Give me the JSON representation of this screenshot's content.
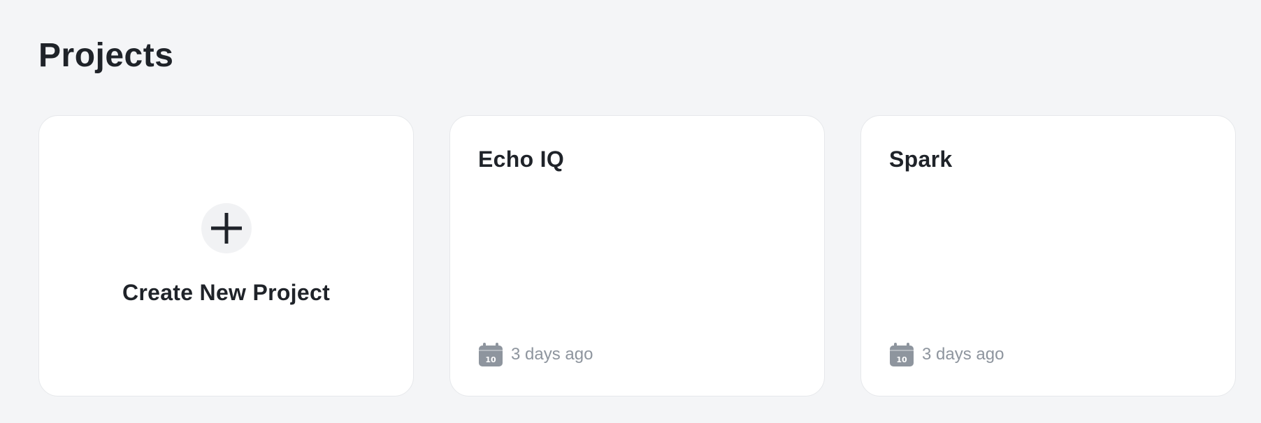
{
  "page": {
    "title": "Projects"
  },
  "create_card": {
    "label": "Create New Project",
    "icon": "plus-icon"
  },
  "projects": [
    {
      "name": "Echo IQ",
      "updated": "3 days ago",
      "icon": "calendar-icon"
    },
    {
      "name": "Spark",
      "updated": "3 days ago",
      "icon": "calendar-icon"
    }
  ],
  "colors": {
    "background": "#f4f5f7",
    "card": "#ffffff",
    "card_border": "#e6e8eb",
    "text_primary": "#1f2329",
    "text_muted": "#8e959e",
    "icon_muted": "#8e959e"
  }
}
